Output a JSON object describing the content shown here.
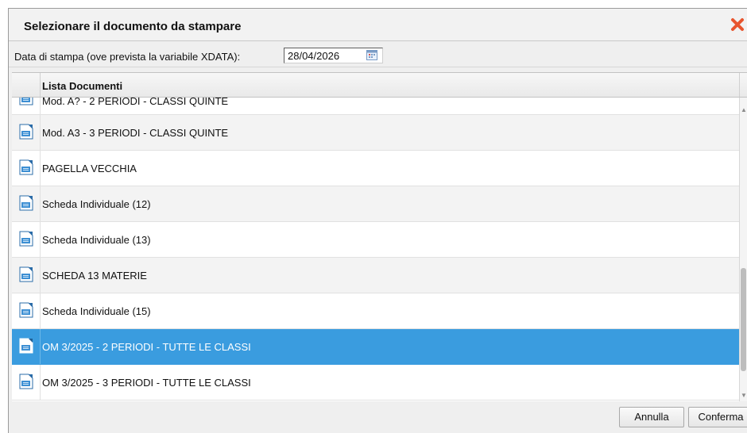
{
  "dialog": {
    "title": "Selezionare il documento da stampare",
    "close_icon": "close-x-icon"
  },
  "print_date": {
    "label": "Data di stampa (ove prevista la variabile XDATA):",
    "value": "28/04/2026",
    "icon": "calendar-icon"
  },
  "list": {
    "header": "Lista Documenti",
    "items": [
      {
        "label": "Mod. A? - 2 PERIODI - CLASSI QUINTE",
        "selected": false
      },
      {
        "label": "Mod. A3 - 3 PERIODI - CLASSI QUINTE",
        "selected": false
      },
      {
        "label": "PAGELLA VECCHIA",
        "selected": false
      },
      {
        "label": "Scheda Individuale (12)",
        "selected": false
      },
      {
        "label": "Scheda Individuale (13)",
        "selected": false
      },
      {
        "label": "SCHEDA 13 MATERIE",
        "selected": false
      },
      {
        "label": "Scheda Individuale (15)",
        "selected": false
      },
      {
        "label": "OM 3/2025 - 2 PERIODI - TUTTE LE CLASSI",
        "selected": true
      },
      {
        "label": "OM 3/2025 - 3 PERIODI - TUTTE LE CLASSI",
        "selected": false
      }
    ],
    "item_icon": "document-icon"
  },
  "buttons": {
    "cancel": "Annulla",
    "confirm": "Conferma"
  },
  "colors": {
    "selection": "#3a9cdf",
    "close": "#e8552e"
  }
}
